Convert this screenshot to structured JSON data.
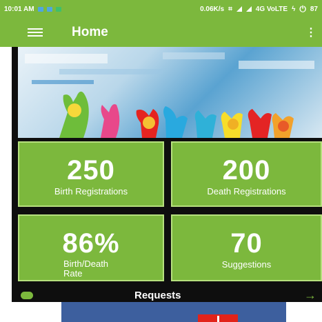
{
  "status": {
    "time": "10:01 AM",
    "speed": "0.06K/s",
    "network": "4G VoLTE",
    "battery": "87",
    "icons": [
      "image-notification-icon",
      "image-notification-icon",
      "app-notification-icon",
      "vibrate-icon",
      "signal-icon",
      "signal-icon",
      "charging-icon",
      "power-icon"
    ]
  },
  "toolbar": {
    "title": "Home",
    "menu_icon": "hamburger-menu-icon",
    "more_icon": "vertical-ellipsis-icon"
  },
  "banner": {
    "image": "painted-hands-smiley-faces"
  },
  "stats": [
    {
      "value": "250",
      "label": "Birth Registrations"
    },
    {
      "value": "200",
      "label": "Death Registrations"
    },
    {
      "value": "86%",
      "label": "Birth/Death Rate"
    },
    {
      "value": "70",
      "label": "Suggestions"
    }
  ],
  "requests": {
    "title": "Requests",
    "left_icon": "cloud-download-icon",
    "right_icon": "arrow-right-icon"
  },
  "colors": {
    "primary": "#7cb83d",
    "card_border": "#b6e07e",
    "dark": "#0e0e0e",
    "preview_blue": "#3d5f9e",
    "preview_red": "#e2231a"
  }
}
